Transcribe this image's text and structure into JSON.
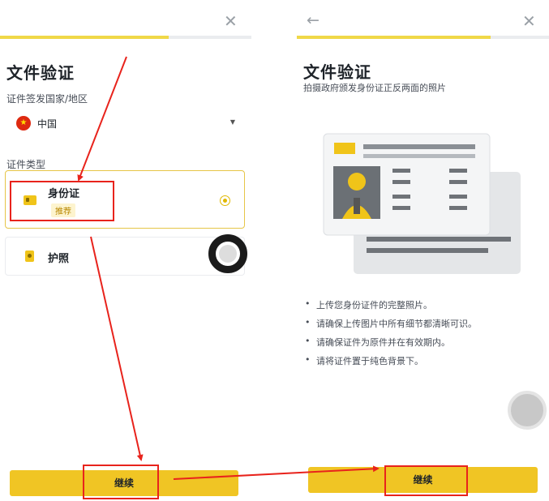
{
  "left": {
    "close_glyph": "✕",
    "progress_pct": 67,
    "title": "文件验证",
    "country_label": "证件签发国家/地区",
    "country_value": "中国",
    "doc_type_label": "证件类型",
    "options": [
      {
        "name": "身份证",
        "badge": "推荐",
        "selected": true,
        "icon": "id-card-icon"
      },
      {
        "name": "护照",
        "selected": false,
        "icon": "passport-icon"
      }
    ],
    "continue_label": "继续"
  },
  "right": {
    "back_glyph": "←",
    "close_glyph": "✕",
    "progress_pct": 77,
    "title": "文件验证",
    "subtitle": "拍摄政府颁发身份证正反两面的照片",
    "tips": [
      "上传您身份证件的完整照片。",
      "请确保上传图片中所有细节都清晰可识。",
      "请确保证件为原件并在有效期内。",
      "请将证件置于纯色背景下。"
    ],
    "continue_label": "继续"
  },
  "colors": {
    "accent": "#F0C524",
    "highlight": "#E8231C",
    "progress_track": "#EAECEF"
  }
}
